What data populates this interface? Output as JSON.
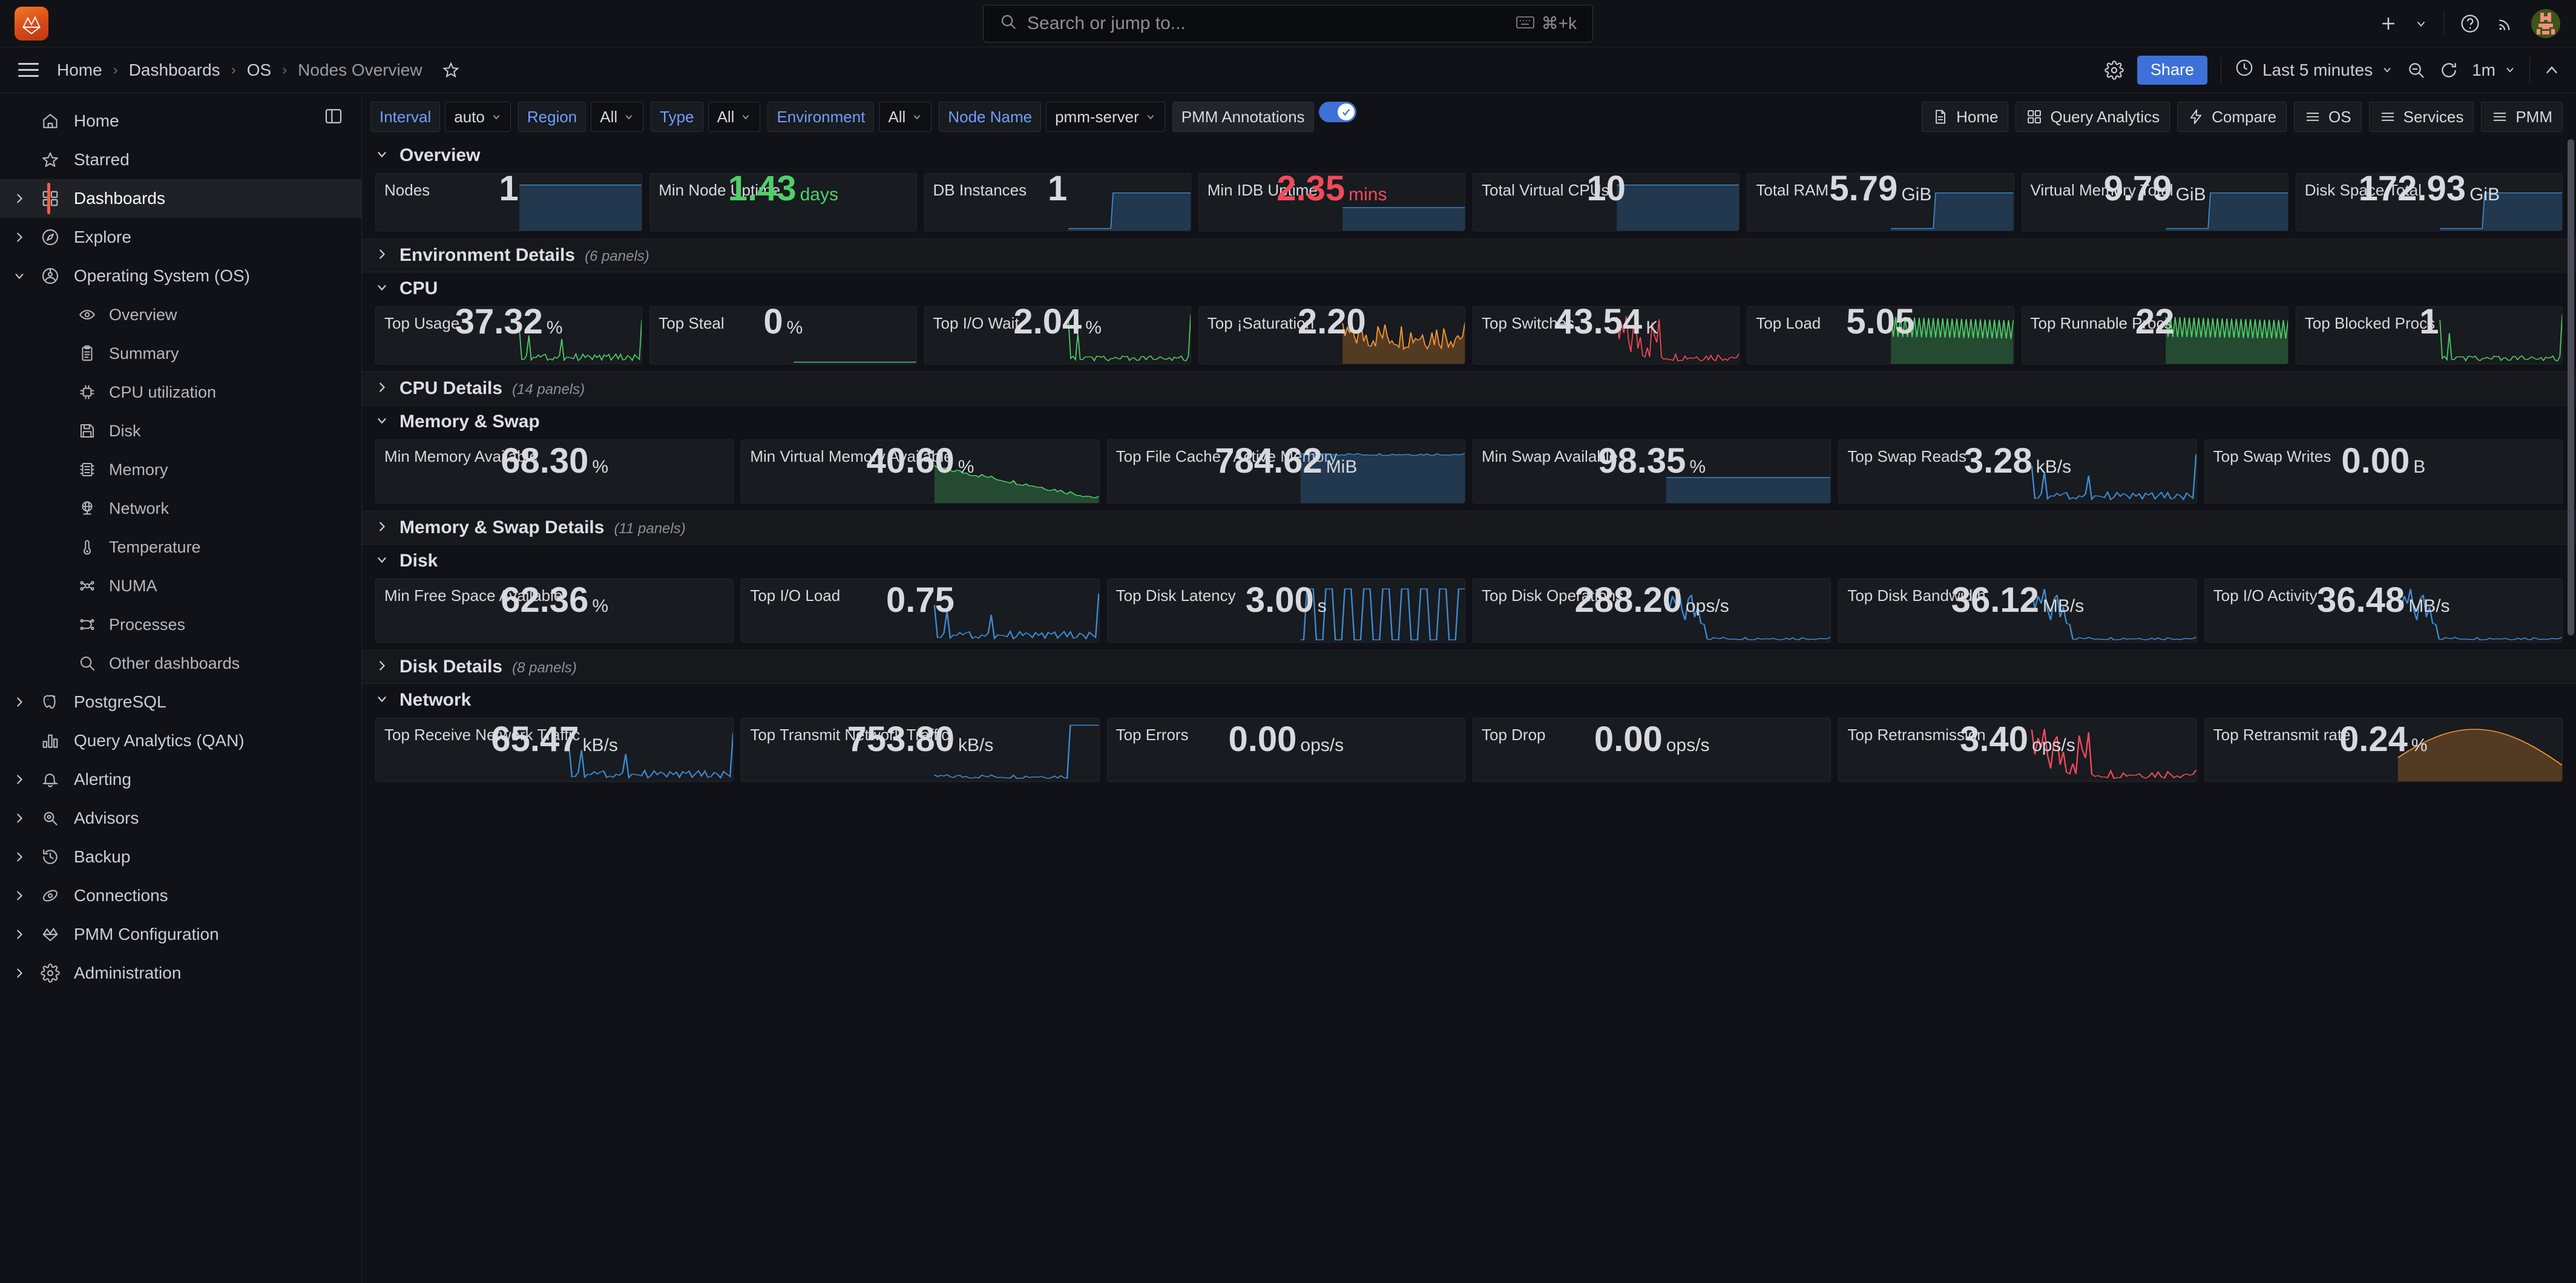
{
  "topbar": {
    "logo_icon": "grafana-logo-icon",
    "search": {
      "placeholder": "Search or jump to...",
      "shortcut": "⌘+k",
      "icon": "search-icon",
      "kbd_icon": "keyboard-icon"
    },
    "new_label": "+",
    "icons": [
      "plus-icon",
      "chevron-down-icon",
      "help-circle-icon",
      "news-rss-icon",
      "user-avatar"
    ]
  },
  "breadcrumb": {
    "menu_icon": "hamburger-menu-icon",
    "items": [
      "Home",
      "Dashboards",
      "OS",
      "Nodes Overview"
    ],
    "star_icon": "star-outline-icon",
    "settings_icon": "gear-icon",
    "share_label": "Share",
    "time_range": "Last 5 minutes",
    "clock_icon": "clock-icon",
    "zoom_out_icon": "zoom-out-icon",
    "refresh_icon": "refresh-icon",
    "refresh_interval": "1m",
    "collapse_icon": "chevron-up-icon"
  },
  "sidebar": {
    "dock_icon": "dock-menu-icon",
    "items": [
      {
        "label": "Home",
        "icon": "home-icon",
        "expandable": false,
        "sub": false,
        "active": false
      },
      {
        "label": "Starred",
        "icon": "star-icon",
        "expandable": false,
        "sub": false,
        "active": false
      },
      {
        "label": "Dashboards",
        "icon": "dashboards-grid-icon",
        "expandable": true,
        "sub": false,
        "active": true
      },
      {
        "label": "Explore",
        "icon": "compass-icon",
        "expandable": true,
        "sub": false,
        "active": false
      },
      {
        "label": "Operating System (OS)",
        "icon": "os-gauge-icon",
        "expandable": true,
        "expanded": true,
        "sub": false,
        "active": false
      },
      {
        "label": "Overview",
        "icon": "eye-icon",
        "expandable": false,
        "sub": true,
        "active": false
      },
      {
        "label": "Summary",
        "icon": "clipboard-icon",
        "expandable": false,
        "sub": true,
        "active": false
      },
      {
        "label": "CPU utilization",
        "icon": "cpu-chip-icon",
        "expandable": false,
        "sub": true,
        "active": false
      },
      {
        "label": "Disk",
        "icon": "floppy-disk-icon",
        "expandable": false,
        "sub": true,
        "active": false
      },
      {
        "label": "Memory",
        "icon": "memory-chip-icon",
        "expandable": false,
        "sub": true,
        "active": false
      },
      {
        "label": "Network",
        "icon": "globe-network-icon",
        "expandable": false,
        "sub": true,
        "active": false
      },
      {
        "label": "Temperature",
        "icon": "thermometer-icon",
        "expandable": false,
        "sub": true,
        "active": false
      },
      {
        "label": "NUMA",
        "icon": "numa-nodes-icon",
        "expandable": false,
        "sub": true,
        "active": false
      },
      {
        "label": "Processes",
        "icon": "processes-flow-icon",
        "expandable": false,
        "sub": true,
        "active": false
      },
      {
        "label": "Other dashboards",
        "icon": "search-icon",
        "expandable": false,
        "sub": true,
        "active": false
      },
      {
        "label": "PostgreSQL",
        "icon": "postgresql-elephant-icon",
        "expandable": true,
        "sub": false,
        "active": false
      },
      {
        "label": "Query Analytics (QAN)",
        "icon": "bar-chart-icon",
        "expandable": false,
        "sub": false,
        "active": false
      },
      {
        "label": "Alerting",
        "icon": "bell-icon",
        "expandable": true,
        "sub": false,
        "active": false
      },
      {
        "label": "Advisors",
        "icon": "magnifier-eye-icon",
        "expandable": true,
        "sub": false,
        "active": false
      },
      {
        "label": "Backup",
        "icon": "history-restore-icon",
        "expandable": true,
        "sub": false,
        "active": false
      },
      {
        "label": "Connections",
        "icon": "connections-icon",
        "expandable": true,
        "sub": false,
        "active": false
      },
      {
        "label": "PMM Configuration",
        "icon": "pmm-logo-icon",
        "expandable": true,
        "sub": false,
        "active": false
      },
      {
        "label": "Administration",
        "icon": "gear-icon",
        "expandable": true,
        "sub": false,
        "active": false
      }
    ]
  },
  "variables": [
    {
      "label": "Interval",
      "value": "auto",
      "type": "select"
    },
    {
      "label": "Region",
      "value": "All",
      "type": "select"
    },
    {
      "label": "Type",
      "value": "All",
      "type": "select"
    },
    {
      "label": "Environment",
      "value": "All",
      "type": "select"
    },
    {
      "label": "Node Name",
      "value": "pmm-server",
      "type": "select"
    }
  ],
  "annotations": {
    "label": "PMM Annotations",
    "enabled": true
  },
  "nav_buttons": [
    {
      "label": "Home",
      "icon": "document-icon"
    },
    {
      "label": "Query Analytics",
      "icon": "grid-icon"
    },
    {
      "label": "Compare",
      "icon": "bolt-icon"
    },
    {
      "label": "OS",
      "icon": "list-icon"
    },
    {
      "label": "Services",
      "icon": "list-icon"
    },
    {
      "label": "PMM",
      "icon": "list-icon"
    }
  ],
  "rows": [
    {
      "title": "Overview",
      "collapsed": false,
      "panel_count": null,
      "panels": [
        {
          "title": "Nodes",
          "value": "1",
          "unit": "",
          "color": "white",
          "spark": "step-up",
          "sparkcolor": "#3d8bd4"
        },
        {
          "title": "Min Node Uptime",
          "value": "1.43",
          "unit": "days",
          "color": "green",
          "spark": "none",
          "sparkcolor": "#4fd068"
        },
        {
          "title": "DB Instances",
          "value": "1",
          "unit": "",
          "color": "white",
          "spark": "step-up-late",
          "sparkcolor": "#3d8bd4"
        },
        {
          "title": "Min IDB Uptime",
          "value": "2.35",
          "unit": "mins",
          "color": "red",
          "spark": "flat-low",
          "sparkcolor": "#3d8bd4"
        },
        {
          "title": "Total Virtual CPUs",
          "value": "10",
          "unit": "",
          "color": "white",
          "spark": "step-up",
          "sparkcolor": "#3d8bd4"
        },
        {
          "title": "Total RAM",
          "value": "5.79",
          "unit": "GiB",
          "color": "white",
          "spark": "step-up-late",
          "sparkcolor": "#3d8bd4"
        },
        {
          "title": "Virtual Memory Total",
          "value": "9.79",
          "unit": "GiB",
          "color": "white",
          "spark": "step-up-late",
          "sparkcolor": "#3d8bd4"
        },
        {
          "title": "Disk Space Total",
          "value": "172.93",
          "unit": "GiB",
          "color": "white",
          "spark": "step-up-late",
          "sparkcolor": "#3d8bd4"
        }
      ]
    },
    {
      "title": "Environment Details",
      "collapsed": true,
      "panel_count": "(6 panels)",
      "panels": []
    },
    {
      "title": "CPU",
      "collapsed": false,
      "panel_count": null,
      "panels": [
        {
          "title": "Top Usage",
          "value": "37.32",
          "unit": "%",
          "color": "white",
          "spark": "spiky",
          "sparkcolor": "#4fd068"
        },
        {
          "title": "Top Steal",
          "value": "0",
          "unit": "%",
          "color": "white",
          "spark": "zero",
          "sparkcolor": "#4fd068"
        },
        {
          "title": "Top I/O Wait",
          "value": "2.04",
          "unit": "%",
          "color": "white",
          "spark": "spiky-low",
          "sparkcolor": "#4fd068"
        },
        {
          "title": "Top ¡Saturation",
          "value": "2.20",
          "unit": "",
          "color": "white",
          "spark": "noisy",
          "sparkcolor": "#ff9830"
        },
        {
          "title": "Top Switches",
          "value": "43.54",
          "unit": "K",
          "color": "white",
          "spark": "burst",
          "sparkcolor": "#f2495c"
        },
        {
          "title": "Top Load",
          "value": "5.05",
          "unit": "",
          "color": "white",
          "spark": "sawtooth",
          "sparkcolor": "#4fd068"
        },
        {
          "title": "Top Runnable Procs",
          "value": "22",
          "unit": "",
          "color": "white",
          "spark": "sawtooth",
          "sparkcolor": "#4fd068"
        },
        {
          "title": "Top Blocked Procs",
          "value": "1",
          "unit": "",
          "color": "white",
          "spark": "spiky-low",
          "sparkcolor": "#4fd068"
        }
      ]
    },
    {
      "title": "CPU Details",
      "collapsed": true,
      "panel_count": "(14 panels)",
      "panels": []
    },
    {
      "title": "Memory & Swap",
      "collapsed": false,
      "panel_count": null,
      "panels": [
        {
          "title": "Min Memory Available",
          "value": "68.30",
          "unit": "%",
          "color": "white",
          "spark": "none",
          "sparkcolor": "#4fd068"
        },
        {
          "title": "Min Virtual Memory Available",
          "value": "40.60",
          "unit": "%",
          "color": "white",
          "spark": "decline",
          "sparkcolor": "#4fd068"
        },
        {
          "title": "Top File Cache / Active Memory",
          "value": "784.62",
          "unit": "MiB",
          "color": "white",
          "spark": "step-up-mid",
          "sparkcolor": "#3d8bd4"
        },
        {
          "title": "Min Swap Available",
          "value": "98.35",
          "unit": "%",
          "color": "white",
          "spark": "flat-low",
          "sparkcolor": "#3d8bd4"
        },
        {
          "title": "Top Swap Reads",
          "value": "3.28",
          "unit": "kB/s",
          "color": "white",
          "spark": "spiky",
          "sparkcolor": "#3d8bd4"
        },
        {
          "title": "Top Swap Writes",
          "value": "0.00",
          "unit": "B",
          "color": "white",
          "spark": "none",
          "sparkcolor": "#3d8bd4"
        }
      ]
    },
    {
      "title": "Memory & Swap Details",
      "collapsed": true,
      "panel_count": "(11 panels)",
      "panels": []
    },
    {
      "title": "Disk",
      "collapsed": false,
      "panel_count": null,
      "panels": [
        {
          "title": "Min Free Space Available",
          "value": "62.36",
          "unit": "%",
          "color": "white",
          "spark": "none",
          "sparkcolor": "#3d8bd4"
        },
        {
          "title": "Top I/O Load",
          "value": "0.75",
          "unit": "",
          "color": "white",
          "spark": "spiky",
          "sparkcolor": "#3d8bd4"
        },
        {
          "title": "Top Disk Latency",
          "value": "3.00",
          "unit": "s",
          "color": "white",
          "spark": "square-wave",
          "sparkcolor": "#3d8bd4"
        },
        {
          "title": "Top Disk Operations",
          "value": "288.20",
          "unit": "ops/s",
          "color": "white",
          "spark": "burst-left",
          "sparkcolor": "#3d8bd4"
        },
        {
          "title": "Top Disk Bandwidth",
          "value": "36.12",
          "unit": "MB/s",
          "color": "white",
          "spark": "burst-left",
          "sparkcolor": "#3d8bd4"
        },
        {
          "title": "Top I/O Activity",
          "value": "36.48",
          "unit": "MB/s",
          "color": "white",
          "spark": "burst-left",
          "sparkcolor": "#3d8bd4"
        }
      ]
    },
    {
      "title": "Disk Details",
      "collapsed": true,
      "panel_count": "(8 panels)",
      "panels": []
    },
    {
      "title": "Network",
      "collapsed": false,
      "panel_count": null,
      "panels": [
        {
          "title": "Top Receive Network Traffic",
          "value": "65.47",
          "unit": "kB/s",
          "color": "white",
          "spark": "spiky",
          "sparkcolor": "#3d8bd4"
        },
        {
          "title": "Top Transmit Network Traffic",
          "value": "753.80",
          "unit": "kB/s",
          "color": "white",
          "spark": "spike-right",
          "sparkcolor": "#3d8bd4"
        },
        {
          "title": "Top Errors",
          "value": "0.00",
          "unit": "ops/s",
          "color": "white",
          "spark": "none",
          "sparkcolor": "#3d8bd4"
        },
        {
          "title": "Top Drop",
          "value": "0.00",
          "unit": "ops/s",
          "color": "white",
          "spark": "none",
          "sparkcolor": "#3d8bd4"
        },
        {
          "title": "Top Retransmission",
          "value": "3.40",
          "unit": "ops/s",
          "color": "white",
          "spark": "burst",
          "sparkcolor": "#f2495c"
        },
        {
          "title": "Top Retransmit rate",
          "value": "0.24",
          "unit": "%",
          "color": "white",
          "spark": "hill",
          "sparkcolor": "#ff9830"
        }
      ]
    }
  ],
  "colors": {
    "accent": "#f55f3e",
    "primary_button": "#3d71d9",
    "green": "#4fd068",
    "red": "#f2495c",
    "orange": "#ff9830",
    "blue": "#3d8bd4",
    "panel_bg": "#181b1f",
    "page_bg": "#111217"
  }
}
